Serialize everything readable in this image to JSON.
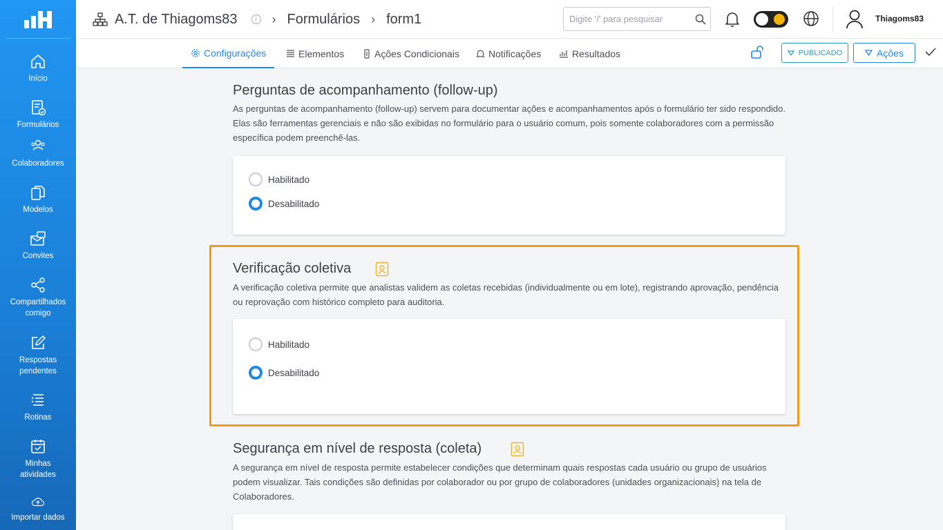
{
  "sidebar": {
    "items": [
      {
        "label": "Início",
        "icon": "home-icon"
      },
      {
        "label": "Formulários",
        "icon": "forms-icon"
      },
      {
        "label": "Colaboradores",
        "icon": "users-icon"
      },
      {
        "label": "Modelos",
        "icon": "copy-icon"
      },
      {
        "label": "Convites",
        "icon": "invite-icon"
      },
      {
        "label": "Compartilhados comigo",
        "icon": "share-icon"
      },
      {
        "label": "Respostas pendentes",
        "icon": "edit-icon"
      },
      {
        "label": "Rotinas",
        "icon": "list-icon"
      },
      {
        "label": "Minhas atividades",
        "icon": "calendar-icon"
      },
      {
        "label": "Importar dados",
        "icon": "upload-icon"
      }
    ]
  },
  "header": {
    "org": "A.T. de Thiagoms83",
    "crumb1": "Formulários",
    "crumb2": "form1",
    "search_placeholder": "Digite '/' para pesquisar",
    "username": "Thiagoms83"
  },
  "tabs": [
    {
      "label": "Configurações",
      "active": true
    },
    {
      "label": "Elementos"
    },
    {
      "label": "Ações Condicionais"
    },
    {
      "label": "Notificações"
    },
    {
      "label": "Resultados"
    }
  ],
  "actions": {
    "published_label": "PUBLICADO",
    "actions_label": "Ações"
  },
  "sections": {
    "followup": {
      "title": "Perguntas de acompanhamento (follow-up)",
      "desc": "As perguntas de acompanhamento (follow-up) servem para documentar ações e acompanhamentos após o formulário ter sido respondido. Elas são ferramentas gerenciais e não são exibidas no formulário para o usuário comum, pois somente colaboradores com a permissão específica podem preenchê-las.",
      "opt_enabled": "Habilitado",
      "opt_disabled": "Desabilitado"
    },
    "collective": {
      "title": "Verificação coletiva",
      "desc": "A verificação coletiva permite que analistas validem as coletas recebidas (individualmente ou em lote), registrando aprovação, pendência ou reprovação com histórico completo para auditoria.",
      "opt_enabled": "Habilitado",
      "opt_disabled": "Desabilitado"
    },
    "security": {
      "title": "Segurança em nível de resposta (coleta)",
      "desc": "A segurança em nível de resposta permite estabelecer condições que determinam quais respostas cada usuário ou grupo de usuários podem visualizar. Tais condições são definidas por colaborador ou por grupo de colaboradores (unidades organizacionais) na tela de Colaboradores."
    }
  },
  "colors": {
    "sidebar": "#2196f3",
    "accent": "#1e88e5",
    "highlight": "#f59a14",
    "premium_icon": "#f0b429"
  }
}
